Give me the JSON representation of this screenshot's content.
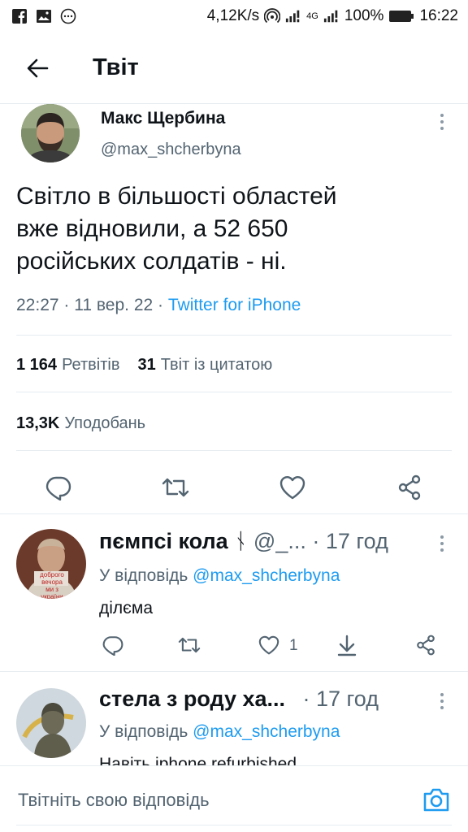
{
  "status_bar": {
    "network_speed": "4,12K/s",
    "network_label": "4G",
    "battery": "100%",
    "time": "16:22"
  },
  "header": {
    "title": "Твіт"
  },
  "tweet": {
    "author_name": "Макс Щербина",
    "author_handle": "@max_shcherbyna",
    "text_line1": "Світло в більшості областей",
    "text_line2": "вже відновили, а 52 650",
    "text_line3": "російських солдатів - ні.",
    "time": "22:27",
    "date": "11 вер. 22",
    "dot": "·",
    "source": "Twitter for iPhone",
    "retweets_count": "1 164",
    "retweets_label": "Ретвітів",
    "quotes_count": "31",
    "quotes_label": "Твіт із цитатою",
    "likes_count": "13,3K",
    "likes_label": "Уподобань"
  },
  "replies": [
    {
      "name": "пємпсі кола",
      "name_suffix": "ᚾ",
      "handle": "@_...",
      "time": "· 17 год",
      "reply_to_prefix": "У відповідь",
      "reply_to_handle": "@max_shcherbyna",
      "text": "ділєма",
      "like_count": "1",
      "avatar_text_line1": "доброго вечора",
      "avatar_text_line2": "ми з україни"
    },
    {
      "name": "стела з роду ха...",
      "time": "· 17 год",
      "reply_to_prefix": "У відповідь",
      "reply_to_handle": "@max_shcherbyna",
      "text": "Навіть iphone refurbished"
    }
  ],
  "compose": {
    "placeholder": "Твітніть свою відповідь"
  },
  "colors": {
    "accent": "#1d9bf0",
    "text": "#0f1419",
    "secondary": "#536471",
    "divider": "#e6ecf0"
  }
}
